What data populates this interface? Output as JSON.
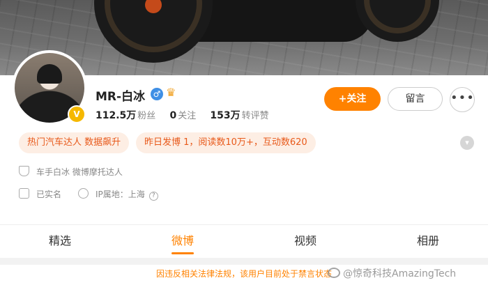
{
  "profile": {
    "name": "MR-白冰",
    "gender_symbol": "♂",
    "crown_symbol": "♛",
    "verified_badge": "V",
    "followers_value": "112.5万",
    "followers_label": "粉丝",
    "following_value": "0",
    "following_label": "关注",
    "likes_value": "153万",
    "likes_label": "转评赞"
  },
  "actions": {
    "follow_label": "+关注",
    "message_label": "留言",
    "more_label": "•••"
  },
  "tags": [
    "热门汽车达人 数据飙升",
    "昨日发博 1，阅读数10万+，互动数620"
  ],
  "info": {
    "bio": "车手白冰 微博摩托达人",
    "realname": "已实名",
    "ip_location": "IP属地：上海"
  },
  "tabs": [
    "精选",
    "微博",
    "视频",
    "相册"
  ],
  "active_tab_index": 1,
  "notice": "因违反相关法律法规，该用户目前处于禁言状态",
  "watermark": "@惊奇科技AmazingTech",
  "colors": {
    "accent": "#ff8200",
    "tag_bg": "#fdeee4",
    "tag_text": "#e8591a",
    "verified": "#f5b800",
    "gender": "#3f8fe5"
  },
  "icons": {
    "bio": "shield-icon",
    "realname": "id-card-icon",
    "ip": "ip-icon",
    "help": "question-icon",
    "more": "more-dots-icon",
    "expand": "chevron-down-icon"
  }
}
